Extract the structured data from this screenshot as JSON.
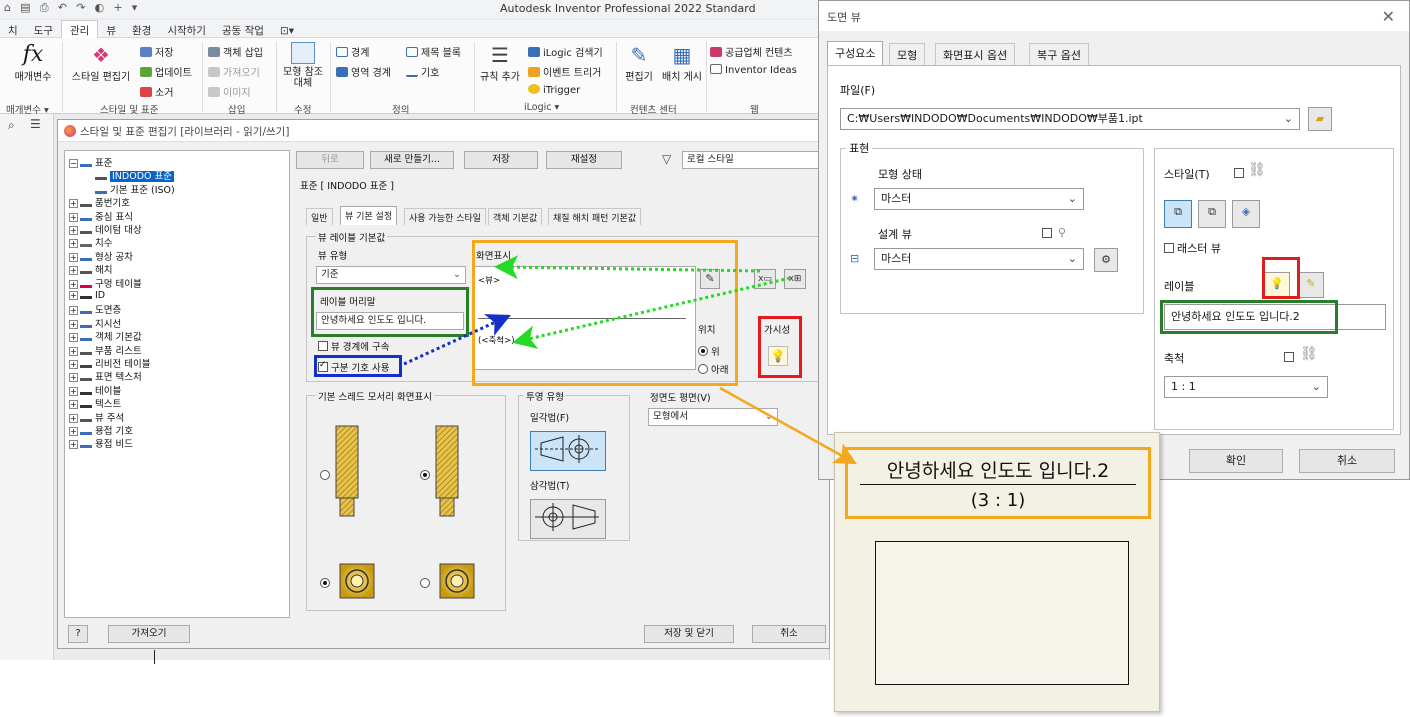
{
  "app": {
    "title": "Autodesk Inventor Professional 2022   Standard",
    "ribbon_tabs": [
      "치",
      "도구",
      "관리",
      "뷰",
      "환경",
      "시작하기",
      "공동 작업",
      "⊡▾"
    ],
    "active_tab": "관리",
    "ribbon": {
      "params_label": "매개변수",
      "style_editor": "스타일 편집기",
      "save": "저장",
      "update": "업데이트",
      "purge": "소거",
      "insert_object": "객체 삽입",
      "import": "가져오기",
      "image": "이미지",
      "model_ref_replace_1": "모형 참조",
      "model_ref_replace_2": "대체",
      "boundary": "경계",
      "region_boundary": "영역 경계",
      "title_block": "제목 블록",
      "symbol": "기호",
      "rule_add": "규칙 추가",
      "ilogic_browser": "iLogic 검색기",
      "event_trigger": "이벤트 트리거",
      "itrigger": "iTrigger",
      "editor": "편집기",
      "layout_publish": "배치 게시",
      "supplier_content": "공급업체 컨텐츠",
      "inventor_ideas": "Inventor Ideas",
      "groups": [
        "매개변수 ▾",
        "스타일 및 표준",
        "삽입",
        "수정",
        "정의",
        "iLogic ▾",
        "컨텐츠 센터",
        "웹"
      ]
    }
  },
  "style_editor": {
    "title": "스타일 및 표준 편집기 [라이브러리 - 읽기/쓰기]",
    "tree": [
      {
        "label": "표준",
        "depth": 0,
        "sign": "−"
      },
      {
        "label": "INDODO 표준",
        "depth": 1,
        "selected": true
      },
      {
        "label": "기본 표준 (ISO)",
        "depth": 1
      },
      {
        "label": "품번기호",
        "depth": 0,
        "sign": "+"
      },
      {
        "label": "중심 표식",
        "depth": 0,
        "sign": "+"
      },
      {
        "label": "데이텀 대상",
        "depth": 0,
        "sign": "+"
      },
      {
        "label": "치수",
        "depth": 0,
        "sign": "+"
      },
      {
        "label": "형상 공차",
        "depth": 0,
        "sign": "+"
      },
      {
        "label": "해치",
        "depth": 0,
        "sign": "+"
      },
      {
        "label": "구멍 테이블",
        "depth": 0,
        "sign": "+"
      },
      {
        "label": "ID",
        "depth": 0,
        "sign": "+"
      },
      {
        "label": "도면층",
        "depth": 0,
        "sign": "+"
      },
      {
        "label": "지시선",
        "depth": 0,
        "sign": "+"
      },
      {
        "label": "객체 기본값",
        "depth": 0,
        "sign": "+"
      },
      {
        "label": "부품 리스트",
        "depth": 0,
        "sign": "+"
      },
      {
        "label": "리비전 테이블",
        "depth": 0,
        "sign": "+"
      },
      {
        "label": "표면 텍스처",
        "depth": 0,
        "sign": "+"
      },
      {
        "label": "테이블",
        "depth": 0,
        "sign": "+"
      },
      {
        "label": "텍스트",
        "depth": 0,
        "sign": "+"
      },
      {
        "label": "뷰 주석",
        "depth": 0,
        "sign": "+"
      },
      {
        "label": "용접 기호",
        "depth": 0,
        "sign": "+"
      },
      {
        "label": "용접 비드",
        "depth": 0,
        "sign": "+"
      }
    ],
    "buttons": {
      "back": "뒤로",
      "new": "새로 만들기...",
      "save": "저장",
      "reset": "재설정",
      "import": "가져오기",
      "save_close": "저장 및 닫기",
      "cancel": "취소",
      "help": "?"
    },
    "filter": "로컬 스타일",
    "std_header": "표준 [ INDODO 표준 ]",
    "tabs": [
      "일반",
      "뷰 기본 설정",
      "사용 가능한 스타일",
      "객체 기본값",
      "채질 해치 패턴 기본값"
    ],
    "active_tab": "뷰 기본 설정",
    "view_label_group": "뷰 레이블 기본값",
    "view_type_label": "뷰 유형",
    "view_type_value": "기준",
    "label_prefix_label": "레이블 머리말",
    "label_prefix_value": "안녕하세요 인도도 입니다.",
    "constrain_cb": "뷰 경계에 구속",
    "delimiter_cb": "구분 기호 사용",
    "display_label": "화면표시",
    "display_line1": "<뷰>",
    "display_line2": "(<축척>)",
    "position_label": "위치",
    "pos_top": "위",
    "pos_bottom": "아래",
    "visibility_label": "가시성",
    "thread_group": "기본 스레드 모서리 화면표시",
    "projection_group": "투영 유형",
    "first_angle": "일각법(F)",
    "third_angle": "삼각법(T)",
    "front_plane_label": "정면도 평면(V)",
    "front_plane_value": "모형에서"
  },
  "drawing_view": {
    "title": "도면 뷰",
    "tabs": [
      "구성요소",
      "모형",
      "화면표시 옵션",
      "복구 옵션"
    ],
    "active_tab": "구성요소",
    "file_label": "파일(F)",
    "file_path": "C:₩Users₩INDODO₩Documents₩INDODO₩부품1.ipt",
    "repr_group": "표현",
    "model_state_label": "모형 상태",
    "model_state_value": "마스터",
    "design_view_label": "설계 뷰",
    "design_view_value": "마스터",
    "style_label": "스타일(T)",
    "raster_view": "래스터 뷰",
    "label_label": "레이블",
    "label_value": "안녕하세요 인도도 입니다.2",
    "scale_label": "축척",
    "scale_value": "1 : 1",
    "ok": "확인",
    "cancel": "취소"
  },
  "preview": {
    "line1": "안녕하세요 인도도 입니다.2",
    "line2": "(3 : 1)"
  },
  "colors": {
    "highlight_orange": "#f3a81d",
    "highlight_green": "#2a7d2a",
    "highlight_blue": "#1430c8",
    "highlight_red": "#e01c1c",
    "arrow_green": "#26d926",
    "arrow_blue": "#1430c8"
  }
}
